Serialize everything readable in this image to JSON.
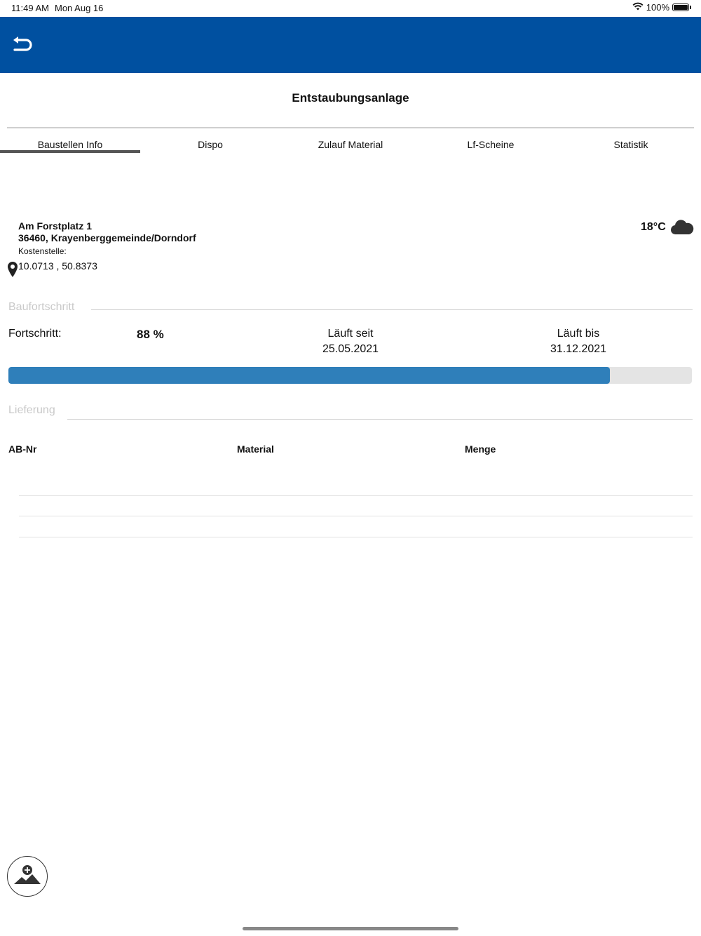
{
  "status_bar": {
    "time": "11:49 AM",
    "date": "Mon Aug 16",
    "battery": "100%",
    "icons": [
      "wifi-icon",
      "battery-icon"
    ]
  },
  "header": {
    "back_icon": "back-arrow-icon",
    "color": "#0050a0"
  },
  "page": {
    "title": "Entstaubungsanlage"
  },
  "tabs": [
    {
      "label": "Baustellen Info",
      "active": true
    },
    {
      "label": "Dispo",
      "active": false
    },
    {
      "label": "Zulauf Material",
      "active": false
    },
    {
      "label": "Lf-Scheine",
      "active": false
    },
    {
      "label": "Statistik",
      "active": false
    }
  ],
  "site": {
    "street": "Am Forstplatz 1",
    "city": "36460, Krayenberggemeinde/Dorndorf",
    "cost_center_label": "Kostenstelle:",
    "coordinates": "10.0713 , 50.8373",
    "pin_icon": "location-pin-icon"
  },
  "weather": {
    "temperature": "18°C",
    "icon": "cloud-icon"
  },
  "progress": {
    "section_title": "Baufortschritt",
    "label": "Fortschritt:",
    "percent_text": "88 %",
    "percent_value": 88,
    "started_label": "Läuft seit",
    "started_date": "25.05.2021",
    "until_label": "Läuft bis",
    "until_date": "31.12.2021",
    "bar_color": "#2f7fba"
  },
  "delivery": {
    "section_title": "Lieferung",
    "columns": [
      "AB-Nr",
      "Material",
      "Menge"
    ],
    "rows": []
  },
  "fab": {
    "icon": "add-user-icon"
  }
}
